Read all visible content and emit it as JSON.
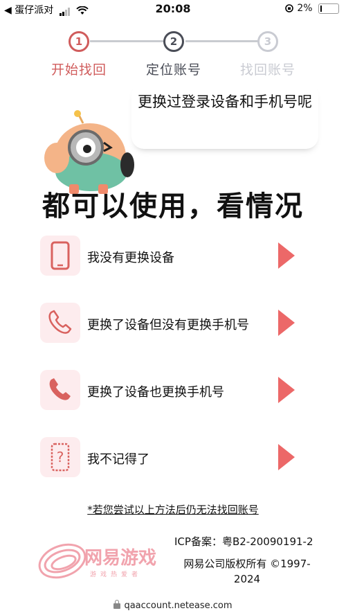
{
  "status_bar": {
    "back_app": "◀ 蛋仔派对",
    "time": "20:08",
    "battery": "2%"
  },
  "stepper": {
    "steps": [
      {
        "number": "1",
        "label": "开始找回",
        "color": "#d05c5c"
      },
      {
        "number": "2",
        "label": "定位账号",
        "color": "#4a4d57"
      },
      {
        "number": "3",
        "label": "找回账号",
        "color": "#c9cbd2"
      }
    ]
  },
  "bubble_text": "更换过登录设备和手机号呢",
  "headline": "都可以使用，看情况",
  "options": [
    {
      "label": "我没有更换设备",
      "icon": "phone-icon"
    },
    {
      "label": "更换了设备但没有更换手机号",
      "icon": "handset-outline-icon"
    },
    {
      "label": "更换了设备也更换手机号",
      "icon": "handset-filled-icon"
    },
    {
      "label": "我不记得了",
      "icon": "question-icon"
    }
  ],
  "help_link": "*若您尝试以上方法后仍无法找回账号",
  "footer": {
    "logo_text": "网易游戏",
    "logo_slogan": "游戏热爱者",
    "icp": "ICP备案：粤B2-20090191-2",
    "copyright": "网易公司版权所有 ©1997-2024"
  },
  "url": "qaaccount.netease.com",
  "colors": {
    "accent": "#ec6868",
    "icon_bg": "#fdecee",
    "icon": "#d9625f"
  }
}
